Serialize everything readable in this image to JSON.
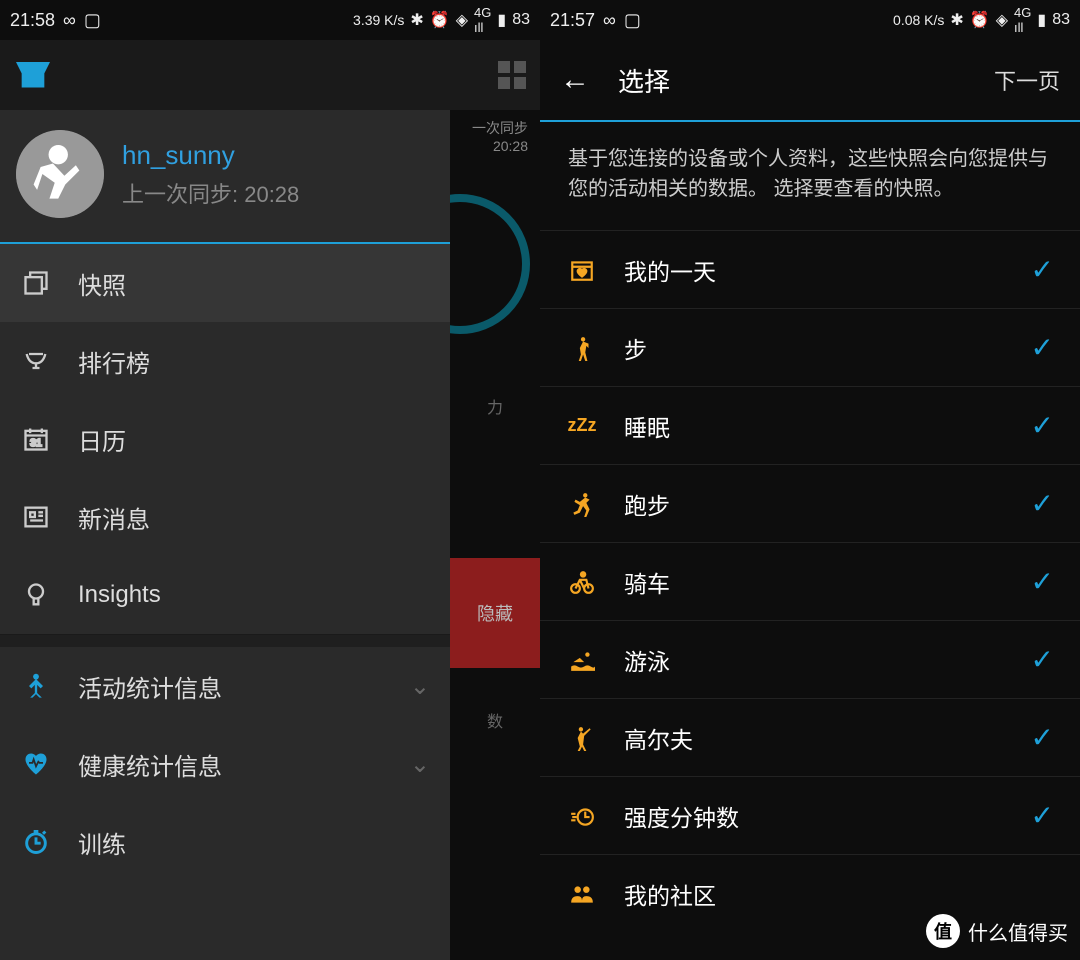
{
  "left": {
    "status": {
      "time": "21:58",
      "speed": "3.39 K/s",
      "battery": "83"
    },
    "profile": {
      "username": "hn_sunny",
      "last_sync": "上一次同步: 20:28"
    },
    "menu": [
      {
        "label": "快照",
        "icon": "snapshot"
      },
      {
        "label": "排行榜",
        "icon": "leaderboard"
      },
      {
        "label": "日历",
        "icon": "calendar"
      },
      {
        "label": "新消息",
        "icon": "news"
      },
      {
        "label": "Insights",
        "icon": "insights"
      }
    ],
    "sections": [
      {
        "label": "活动统计信息",
        "icon": "activity"
      },
      {
        "label": "健康统计信息",
        "icon": "health"
      },
      {
        "label": "训练",
        "icon": "training"
      }
    ],
    "bg": {
      "sync_label": "一次同步",
      "sync_time": "20:28",
      "hide": "隐藏",
      "activity": "力",
      "count": "数"
    }
  },
  "right": {
    "status": {
      "time": "21:57",
      "speed": "0.08 K/s",
      "battery": "83"
    },
    "header": {
      "title": "选择",
      "next": "下一页"
    },
    "description": "基于您连接的设备或个人资料，这些快照会向您提供与您的活动相关的数据。 选择要查看的快照。",
    "items": [
      {
        "label": "我的一天",
        "icon": "calendar-heart"
      },
      {
        "label": "步",
        "icon": "walk"
      },
      {
        "label": "睡眠",
        "icon": "sleep"
      },
      {
        "label": "跑步",
        "icon": "run"
      },
      {
        "label": "骑车",
        "icon": "bike"
      },
      {
        "label": "游泳",
        "icon": "swim"
      },
      {
        "label": "高尔夫",
        "icon": "golf"
      },
      {
        "label": "强度分钟数",
        "icon": "intensity"
      },
      {
        "label": "我的社区",
        "icon": "community"
      }
    ]
  },
  "watermark": "什么值得买"
}
